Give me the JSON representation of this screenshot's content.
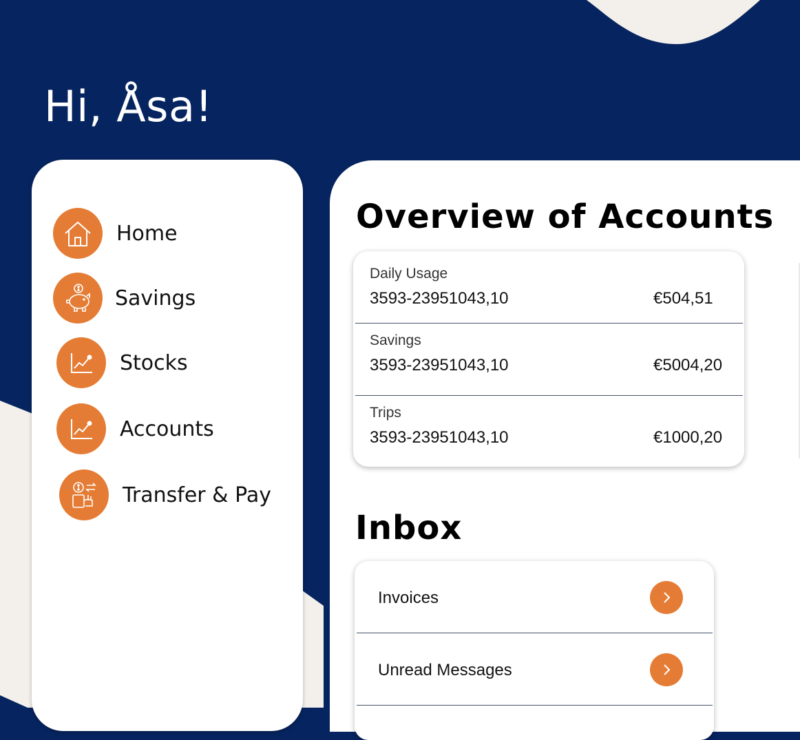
{
  "greeting": "Hi, Åsa!",
  "colors": {
    "navy": "#06245f",
    "accent": "#e57c35",
    "cream": "#f3f0eb",
    "card": "#ffffff"
  },
  "sidebar": {
    "items": [
      {
        "label": "Home",
        "icon": "home-icon"
      },
      {
        "label": "Savings",
        "icon": "piggy-bank-icon"
      },
      {
        "label": "Stocks",
        "icon": "stock-chart-icon"
      },
      {
        "label": "Accounts",
        "icon": "account-chart-icon"
      },
      {
        "label": "Transfer & Pay",
        "icon": "transfer-pay-icon"
      }
    ]
  },
  "overview": {
    "title": "Overview of Accounts",
    "accounts": [
      {
        "name": "Daily Usage",
        "number": "3593-23951043,10",
        "balance": "€504,51"
      },
      {
        "name": "Savings",
        "number": "3593-23951043,10",
        "balance": "€5004,20"
      },
      {
        "name": "Trips",
        "number": "3593-23951043,10",
        "balance": "€1000,20"
      }
    ]
  },
  "inbox": {
    "title": "Inbox",
    "items": [
      {
        "label": "Invoices",
        "icon": "chevron-right-icon"
      },
      {
        "label": "Unread Messages",
        "icon": "chevron-right-icon"
      }
    ]
  }
}
